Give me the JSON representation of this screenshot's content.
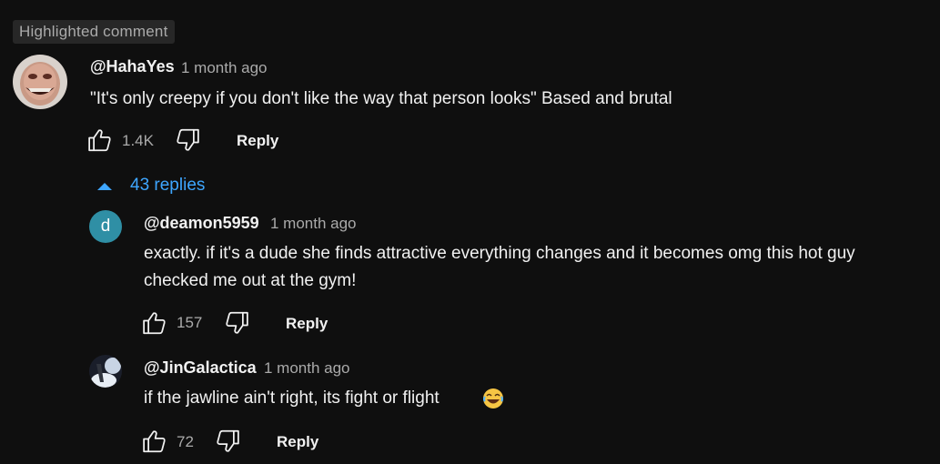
{
  "highlight_badge": "Highlighted comment",
  "comment": {
    "author": "@HahaYes",
    "time": "1 month ago",
    "text": "\"It's only creepy if you don't like the way that person looks\" Based and brutal",
    "likes": "1.4K",
    "reply_label": "Reply"
  },
  "replies_toggle": "43 replies",
  "replies": [
    {
      "avatar_letter": "d",
      "author": "@deamon5959",
      "time": "1 month ago",
      "text_line1": "exactly. if it's a dude she finds attractive everything changes and it becomes omg this hot guy",
      "text_line2": "checked me out at the gym!",
      "likes": "157",
      "reply_label": "Reply"
    },
    {
      "author": "@JinGalactica",
      "time": "1 month ago",
      "text": "if the jawline ain't right, its fight or flight",
      "likes": "72",
      "reply_label": "Reply"
    }
  ],
  "colors": {
    "background": "#0f0f0f",
    "link": "#3ea6ff",
    "muted": "#aaaaaa",
    "avatar_d": "#2f8fa5"
  },
  "icons": [
    "thumb-up-icon",
    "thumb-down-icon",
    "caret-up-icon",
    "laughing-emoji-icon"
  ]
}
